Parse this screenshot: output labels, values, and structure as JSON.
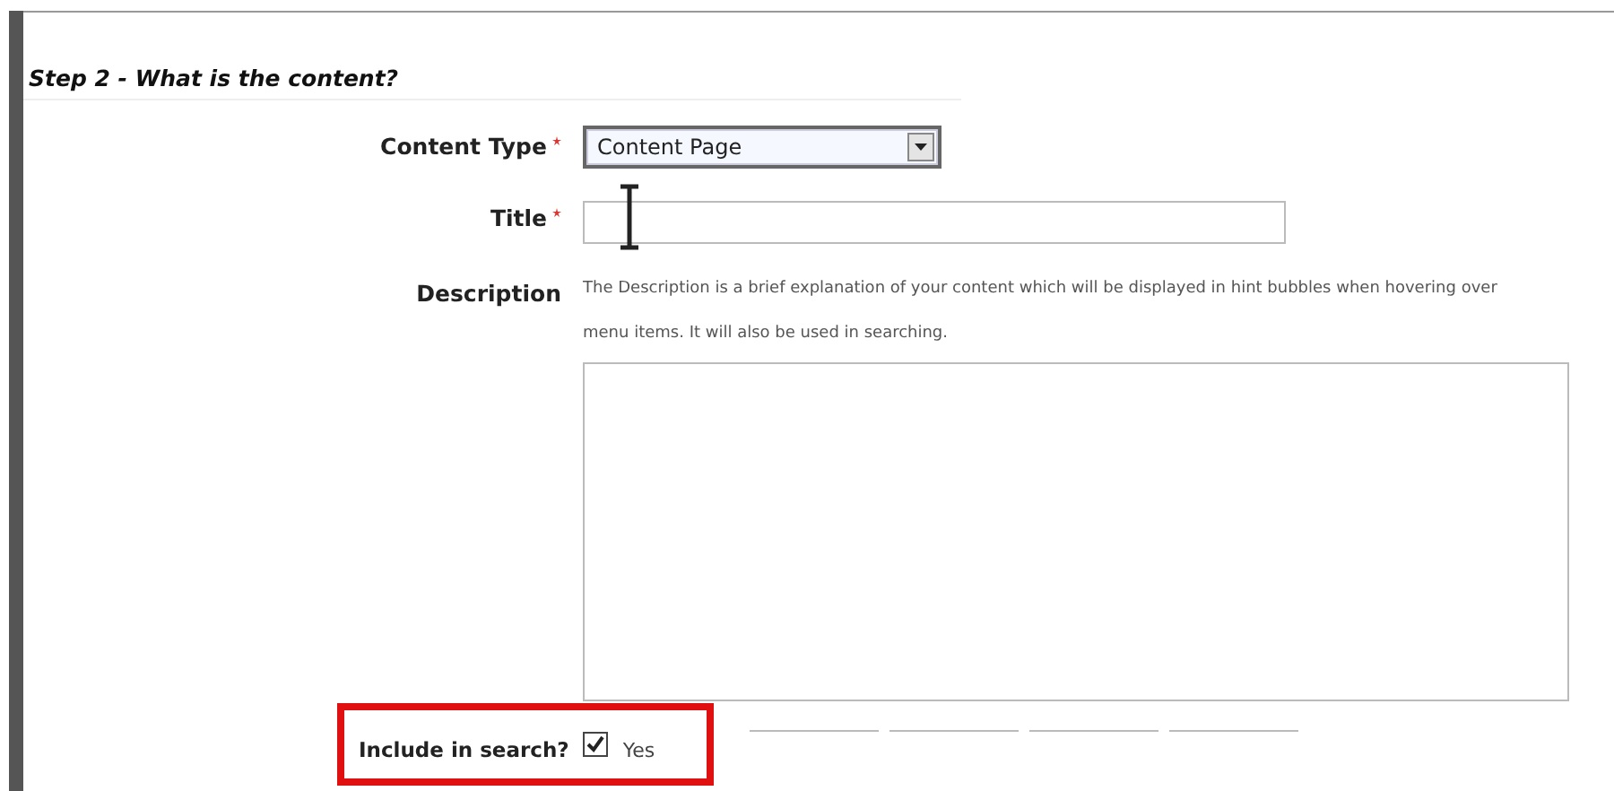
{
  "section_title": "Step 2 - What is the content?",
  "fields": [
    {
      "kind": "select",
      "label": "Content Type",
      "required": true,
      "value": "Content Page"
    },
    {
      "kind": "text",
      "label": "Title",
      "required": true
    },
    {
      "kind": "textarea",
      "label": "Description",
      "required": false,
      "hint": "The Description is a brief explanation of your content which will be displayed in hint bubbles when hovering over menu items. It will also be used in searching."
    }
  ],
  "include_in_search": {
    "label": "Include in search?",
    "checked": true,
    "option": "Yes"
  }
}
